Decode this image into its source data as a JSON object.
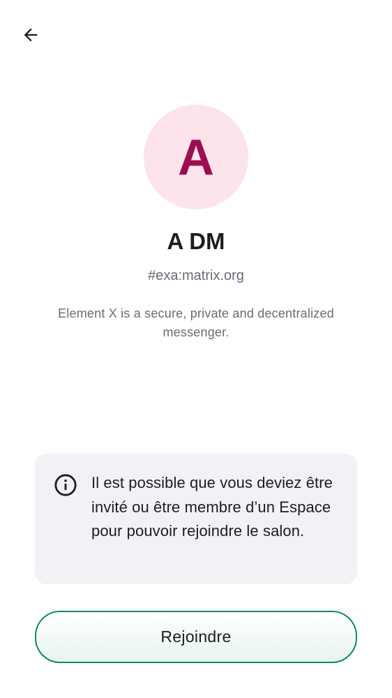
{
  "toolbar": {
    "back_icon": "arrow-left-icon"
  },
  "room": {
    "avatar_letter": "A",
    "name": "A DM",
    "alias": "#exa:matrix.org",
    "topic": "Element X is a secure, private and decentralized messenger."
  },
  "notice": {
    "icon": "info-icon",
    "text": "Il est possible que vous deviez être invité ou être membre d’un Espace pour pouvoir rejoindre le salon."
  },
  "actions": {
    "join_label": "Rejoindre"
  },
  "colors": {
    "avatar_background": "#fde3ea",
    "avatar_letter": "#9b0e4f",
    "notice_background": "#f0f2f5",
    "join_border": "#0b8a6a",
    "secondary_text": "#656d77"
  }
}
